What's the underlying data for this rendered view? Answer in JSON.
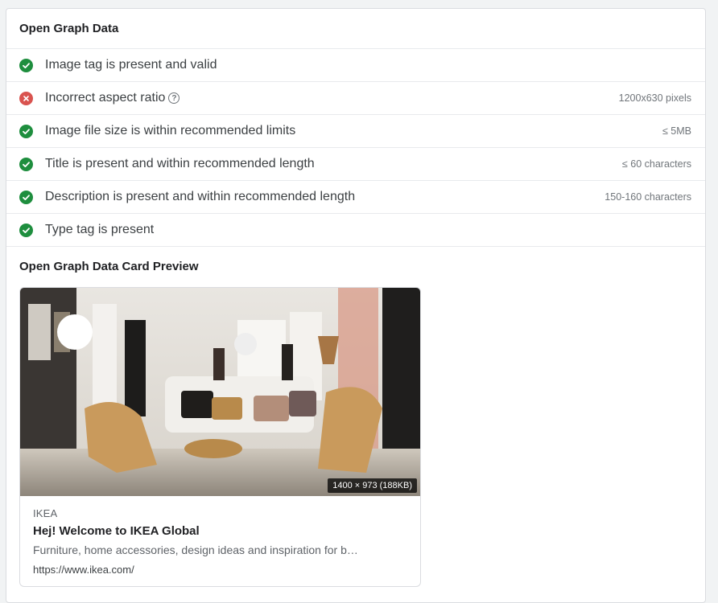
{
  "og_section": {
    "title": "Open Graph Data",
    "checks": [
      {
        "status": "pass",
        "label": "Image tag is present and valid",
        "value": ""
      },
      {
        "status": "fail",
        "label": "Incorrect aspect ratio",
        "value": "1200x630 pixels",
        "help_icon": "question-circle-icon"
      },
      {
        "status": "pass",
        "label": "Image file size is within recommended limits",
        "value": "≤ 5MB"
      },
      {
        "status": "pass",
        "label": "Title is present and within recommended length",
        "value": "≤ 60 characters"
      },
      {
        "status": "pass",
        "label": "Description is present and within recommended length",
        "value": "150-160 characters"
      },
      {
        "status": "pass",
        "label": "Type tag is present",
        "value": ""
      }
    ]
  },
  "preview_section": {
    "title": "Open Graph Data Card Preview",
    "card": {
      "image_meta": "1400 × 973 (188KB)",
      "site": "IKEA",
      "title": "Hej! Welcome to IKEA Global",
      "description": "Furniture, home accessories, design ideas and inspiration for big and small budgets.",
      "url": "https://www.ikea.com/"
    }
  },
  "colors": {
    "pass": "#1e8e3e",
    "fail": "#d9534f",
    "border": "#dadce0",
    "background": "#f1f3f4"
  }
}
